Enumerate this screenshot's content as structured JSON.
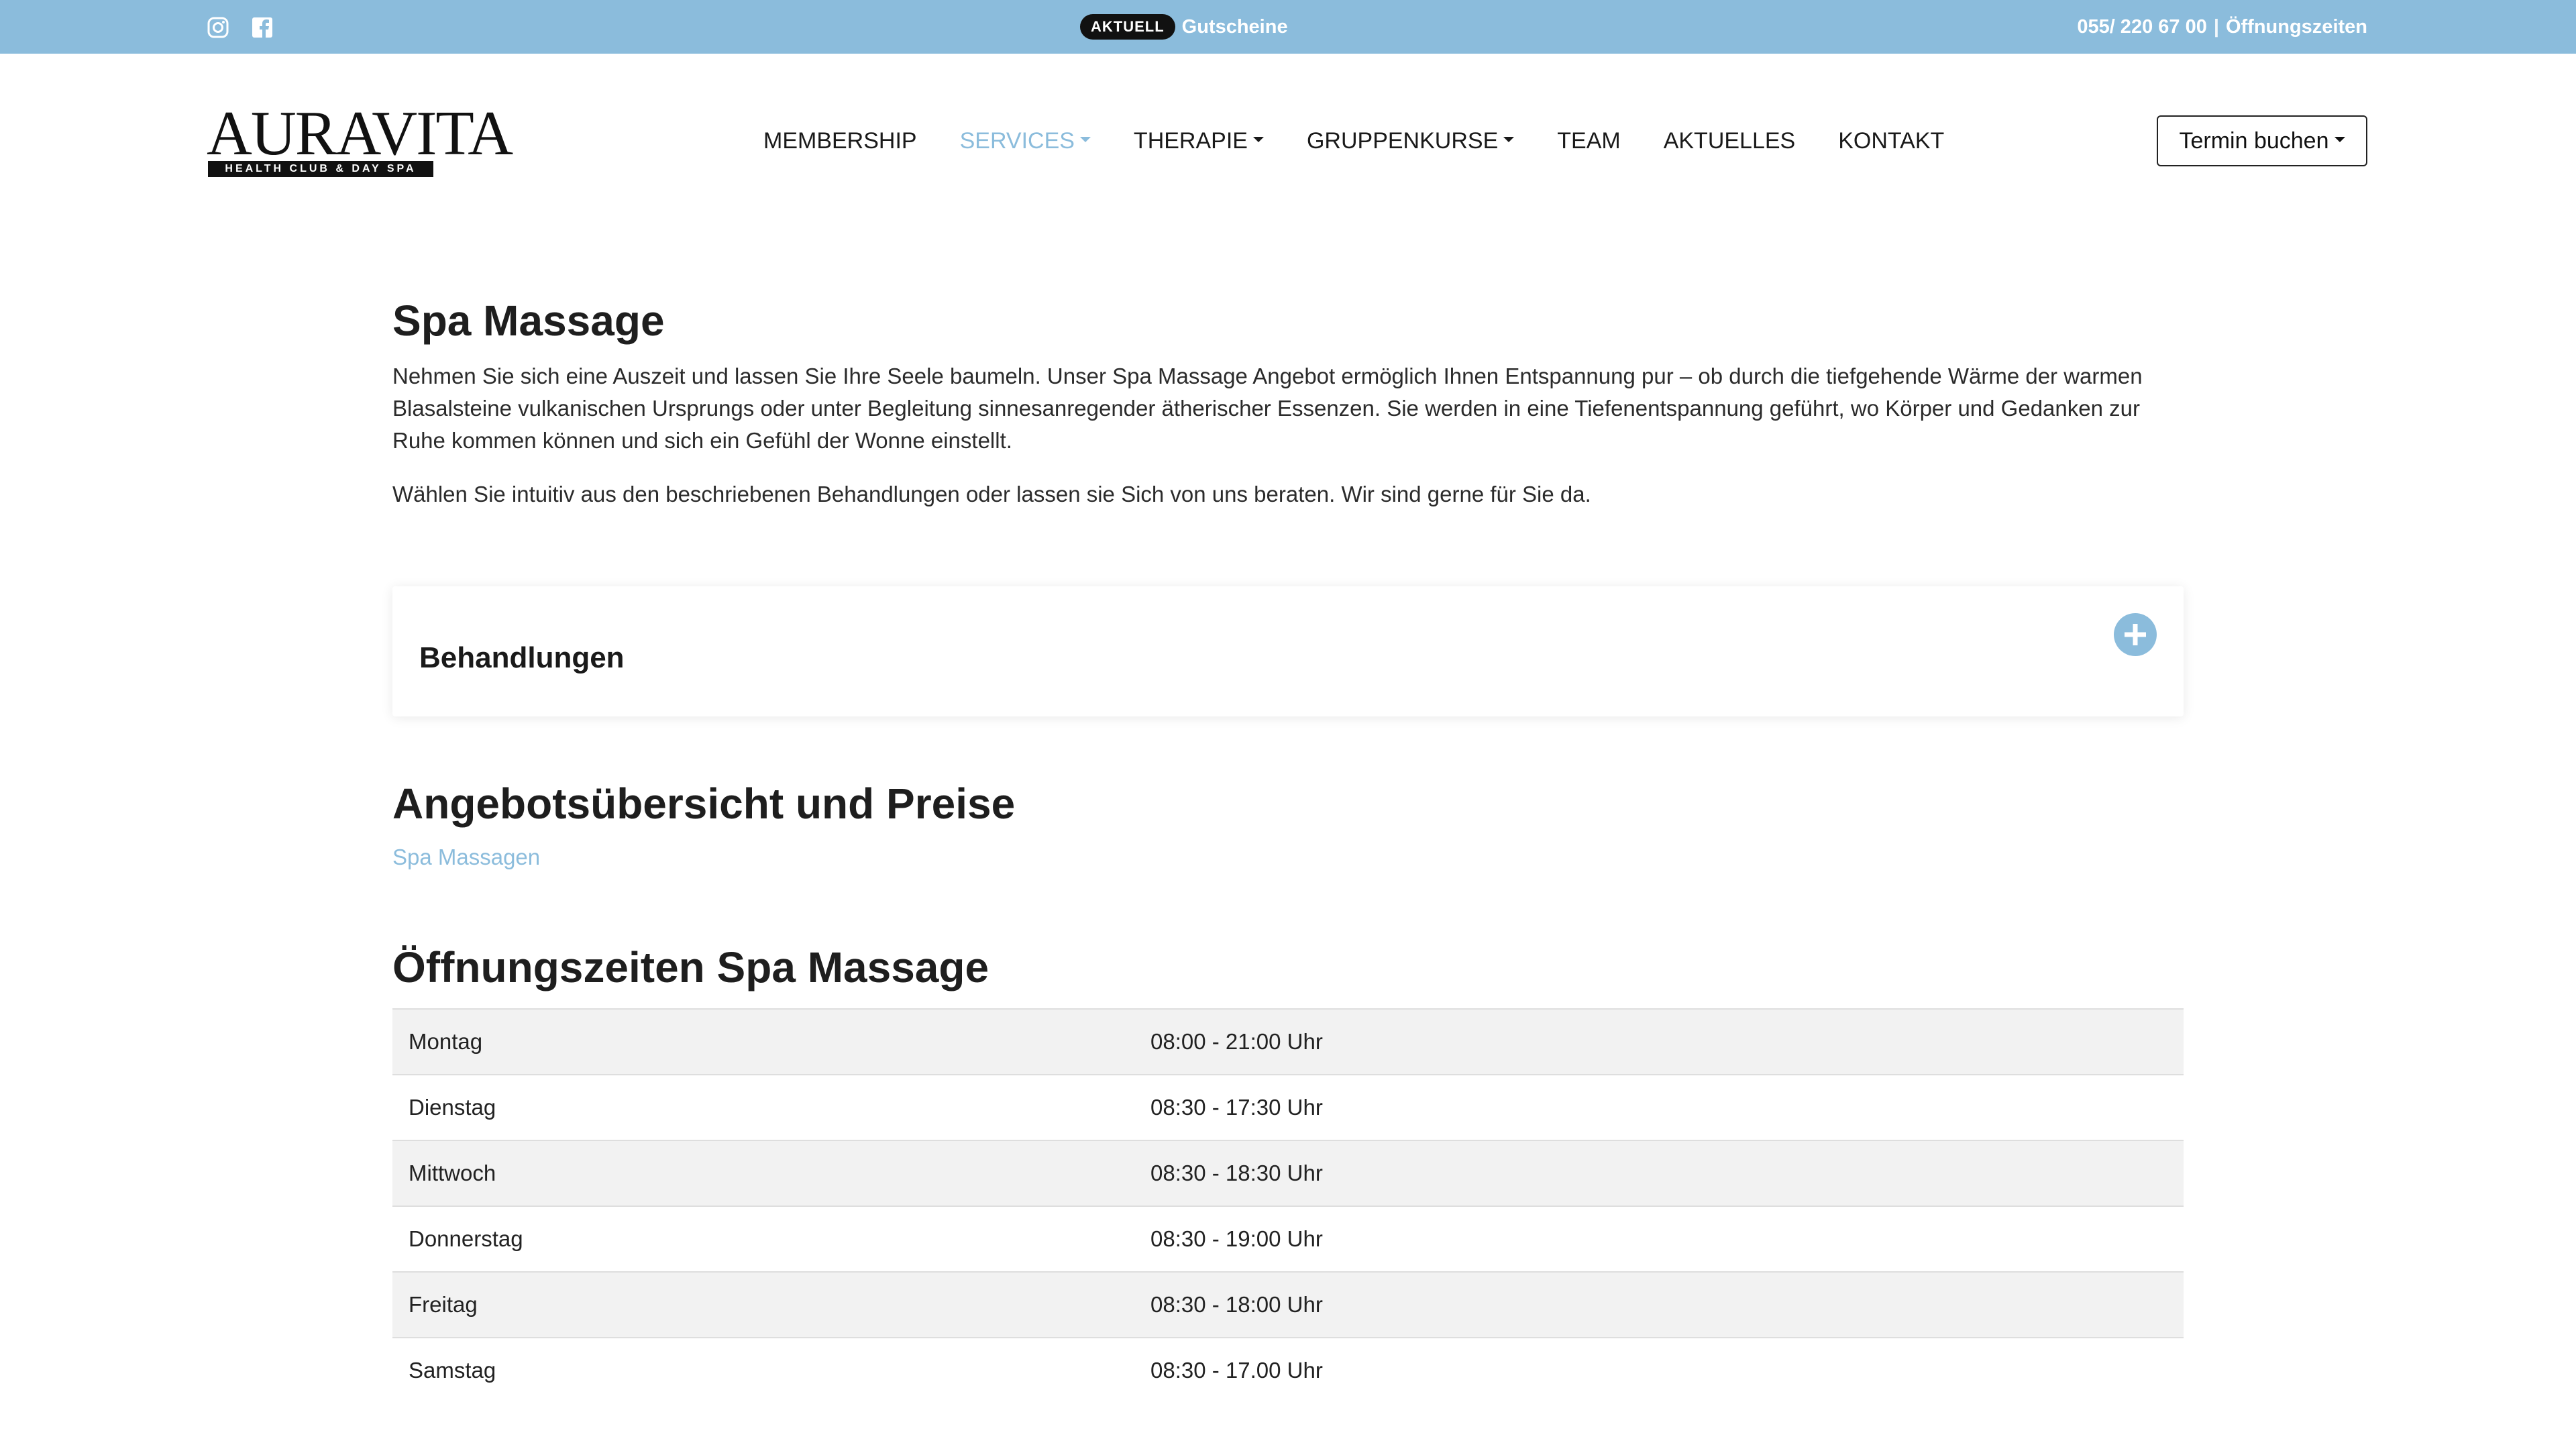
{
  "topbar": {
    "badge": "AKTUELL",
    "promo": "Gutscheine",
    "phone": "055/ 220 67 00",
    "separator": "|",
    "hours_link": "Öffnungszeiten"
  },
  "brand": {
    "logo_word": "AURAVITA",
    "logo_sub": "HEALTH CLUB & DAY SPA"
  },
  "nav": {
    "items": [
      {
        "label": "MEMBERSHIP"
      },
      {
        "label": "SERVICES"
      },
      {
        "label": "THERAPIE"
      },
      {
        "label": "GRUPPENKURSE"
      },
      {
        "label": "TEAM"
      },
      {
        "label": "AKTUELLES"
      },
      {
        "label": "KONTAKT"
      }
    ],
    "book_button": "Termin buchen"
  },
  "page": {
    "title": "Spa Massage",
    "intro_1": "Nehmen Sie sich eine Auszeit und lassen Sie Ihre Seele baumeln. Unser Spa Massage Angebot ermöglich Ihnen Entspannung pur – ob durch die tiefgehende Wärme der warmen Blasalsteine vulkanischen Ursprungs oder unter Begleitung sinnesanregender ätherischer Essenzen. Sie werden in eine Tiefenentspannung geführt, wo Körper und Gedanken zur Ruhe kommen können und sich ein Gefühl der Wonne einstellt.",
    "intro_2": "Wählen Sie intuitiv aus den beschriebenen Behandlungen oder lassen sie Sich von uns beraten. Wir sind gerne für Sie da.",
    "accordion_title": "Behandlungen",
    "offers_heading": "Angebotsübersicht und Preise",
    "offers_link": "Spa Massagen",
    "hours_heading": "Öffnungszeiten Spa Massage",
    "hours": [
      {
        "day": "Montag",
        "time": "08:00 - 21:00 Uhr"
      },
      {
        "day": "Dienstag",
        "time": "08:30 - 17:30 Uhr"
      },
      {
        "day": "Mittwoch",
        "time": "08:30 - 18:30 Uhr"
      },
      {
        "day": "Donnerstag",
        "time": "08:30 - 19:00 Uhr"
      },
      {
        "day": "Freitag",
        "time": "08:30 - 18:00 Uhr"
      },
      {
        "day": "Samstag",
        "time": "08:30 - 17.00 Uhr"
      }
    ]
  },
  "colors": {
    "accent": "#8bbcdc",
    "text": "#222222",
    "badge_bg": "#111111",
    "row_alt": "#f2f2f2"
  },
  "icons": [
    "instagram-icon",
    "facebook-icon",
    "plus-icon",
    "caret-down-icon"
  ]
}
